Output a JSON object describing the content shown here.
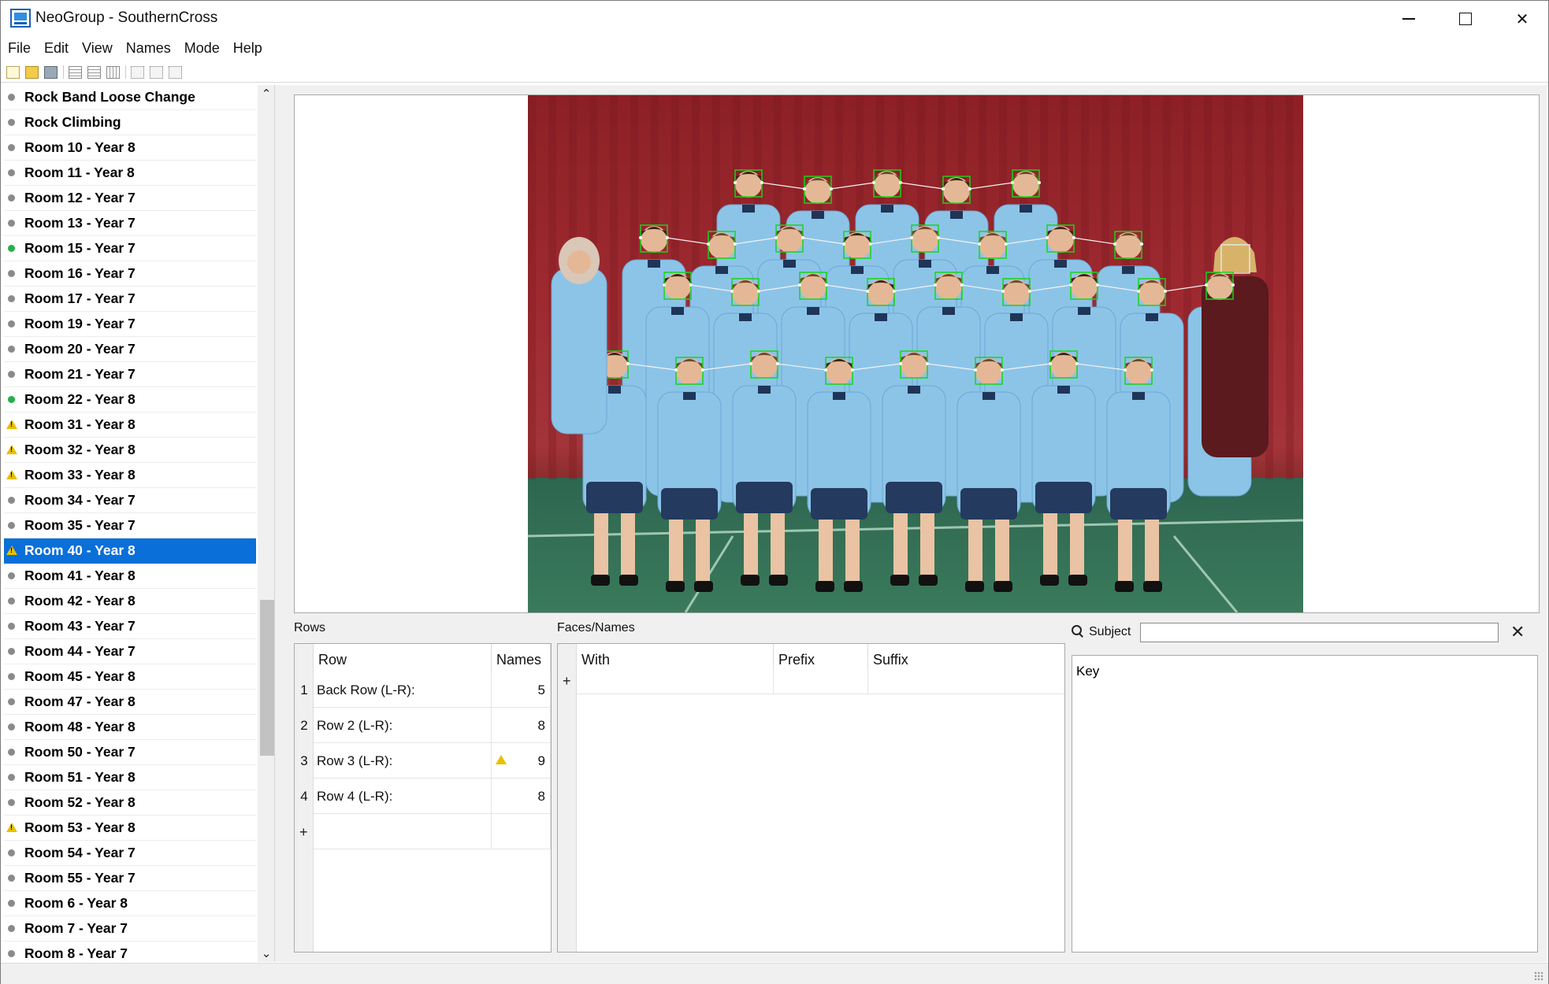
{
  "window": {
    "title": "NeoGroup - SouthernCross"
  },
  "menu": [
    "File",
    "Edit",
    "View",
    "Names",
    "Mode",
    "Help"
  ],
  "toolbar": [
    "new-file-icon",
    "open-folder-icon",
    "save-icon",
    "grid-view-icon",
    "list-view-icon",
    "thumbnail-view-icon",
    "layout-1-icon",
    "layout-2-icon",
    "layout-3-icon"
  ],
  "groups": [
    {
      "label": "Rock Band Loose Change",
      "status": "grey"
    },
    {
      "label": "Rock Climbing",
      "status": "grey"
    },
    {
      "label": "Room 10 - Year 8",
      "status": "grey"
    },
    {
      "label": "Room 11 - Year 8",
      "status": "grey"
    },
    {
      "label": "Room 12 - Year 7",
      "status": "grey"
    },
    {
      "label": "Room 13 - Year 7",
      "status": "grey"
    },
    {
      "label": "Room 15 - Year 7",
      "status": "green"
    },
    {
      "label": "Room 16 - Year 7",
      "status": "grey"
    },
    {
      "label": "Room 17 - Year 7",
      "status": "grey"
    },
    {
      "label": "Room 19 - Year 7",
      "status": "grey"
    },
    {
      "label": "Room 20 - Year 7",
      "status": "grey"
    },
    {
      "label": "Room 21 - Year 7",
      "status": "grey"
    },
    {
      "label": "Room 22 - Year 8",
      "status": "green"
    },
    {
      "label": "Room 31 - Year 8",
      "status": "warn"
    },
    {
      "label": "Room 32 - Year 8",
      "status": "warn"
    },
    {
      "label": "Room 33 - Year 8",
      "status": "warn"
    },
    {
      "label": "Room 34 - Year 7",
      "status": "grey"
    },
    {
      "label": "Room 35 - Year 7",
      "status": "grey"
    },
    {
      "label": "Room 40 - Year 8",
      "status": "warn",
      "selected": true
    },
    {
      "label": "Room 41 - Year 8",
      "status": "grey"
    },
    {
      "label": "Room 42 - Year 8",
      "status": "grey"
    },
    {
      "label": "Room 43 - Year 7",
      "status": "grey"
    },
    {
      "label": "Room 44 - Year 7",
      "status": "grey"
    },
    {
      "label": "Room 45 - Year 8",
      "status": "grey"
    },
    {
      "label": "Room 47 - Year 8",
      "status": "grey"
    },
    {
      "label": "Room 48 - Year 8",
      "status": "grey"
    },
    {
      "label": "Room 50 - Year 7",
      "status": "grey"
    },
    {
      "label": "Room 51 - Year 8",
      "status": "grey"
    },
    {
      "label": "Room 52 - Year 8",
      "status": "grey"
    },
    {
      "label": "Room 53 - Year 8",
      "status": "warn"
    },
    {
      "label": "Room 54 - Year 7",
      "status": "grey"
    },
    {
      "label": "Room 55 - Year 7",
      "status": "grey"
    },
    {
      "label": "Room 6 - Year 8",
      "status": "grey"
    },
    {
      "label": "Room 7 - Year 7",
      "status": "grey"
    },
    {
      "label": "Room 8 - Year 7",
      "status": "grey"
    }
  ],
  "rows_panel": {
    "title": "Rows",
    "headers": {
      "row": "Row",
      "names": "Names"
    },
    "rows": [
      {
        "num": "1",
        "label": "Back Row (L-R):",
        "count": "5",
        "warn": false
      },
      {
        "num": "2",
        "label": "Row 2 (L-R):",
        "count": "8",
        "warn": false
      },
      {
        "num": "3",
        "label": "Row 3 (L-R):",
        "count": "9",
        "warn": true
      },
      {
        "num": "4",
        "label": "Row 4 (L-R):",
        "count": "8",
        "warn": false
      }
    ],
    "add_label": "+"
  },
  "faces_panel": {
    "title": "Faces/Names",
    "headers": {
      "with": "With",
      "prefix": "Prefix",
      "suffix": "Suffix"
    },
    "add_label": "+"
  },
  "subject": {
    "label": "Subject",
    "value": "",
    "clear": "✕"
  },
  "key_panel": {
    "title": "Key"
  },
  "photo": {
    "rows": [
      {
        "people": 5
      },
      {
        "people": 8
      },
      {
        "people": 9
      },
      {
        "people": 8
      }
    ],
    "colors": {
      "curtain": "#9e2a30",
      "uniform": "#8cc4e8",
      "floor": "#3a7a5c",
      "face_box": "#19d319"
    }
  }
}
